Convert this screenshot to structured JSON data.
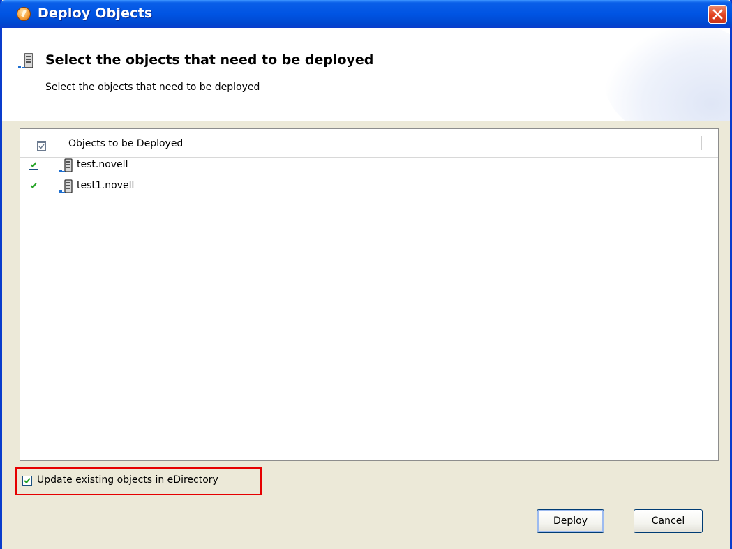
{
  "window": {
    "title": "Deploy Objects"
  },
  "header": {
    "title": "Select the objects that need to be deployed",
    "description": "Select the objects that need to be deployed"
  },
  "table": {
    "column_header": "Objects to be Deployed",
    "rows": [
      {
        "label": "test.novell",
        "checked": true,
        "icon": "server-object-icon"
      },
      {
        "label": "test1.novell",
        "checked": true,
        "icon": "server-object-icon"
      }
    ]
  },
  "options": {
    "update_existing_label": "Update existing objects in eDirectory",
    "update_existing_checked": true
  },
  "buttons": {
    "deploy_label": "Deploy",
    "cancel_label": "Cancel"
  },
  "colors": {
    "titlebar": "#0054e3",
    "highlight_border": "#e60000",
    "dialog_background": "#ece9d8",
    "checkmark": "#21a121"
  }
}
